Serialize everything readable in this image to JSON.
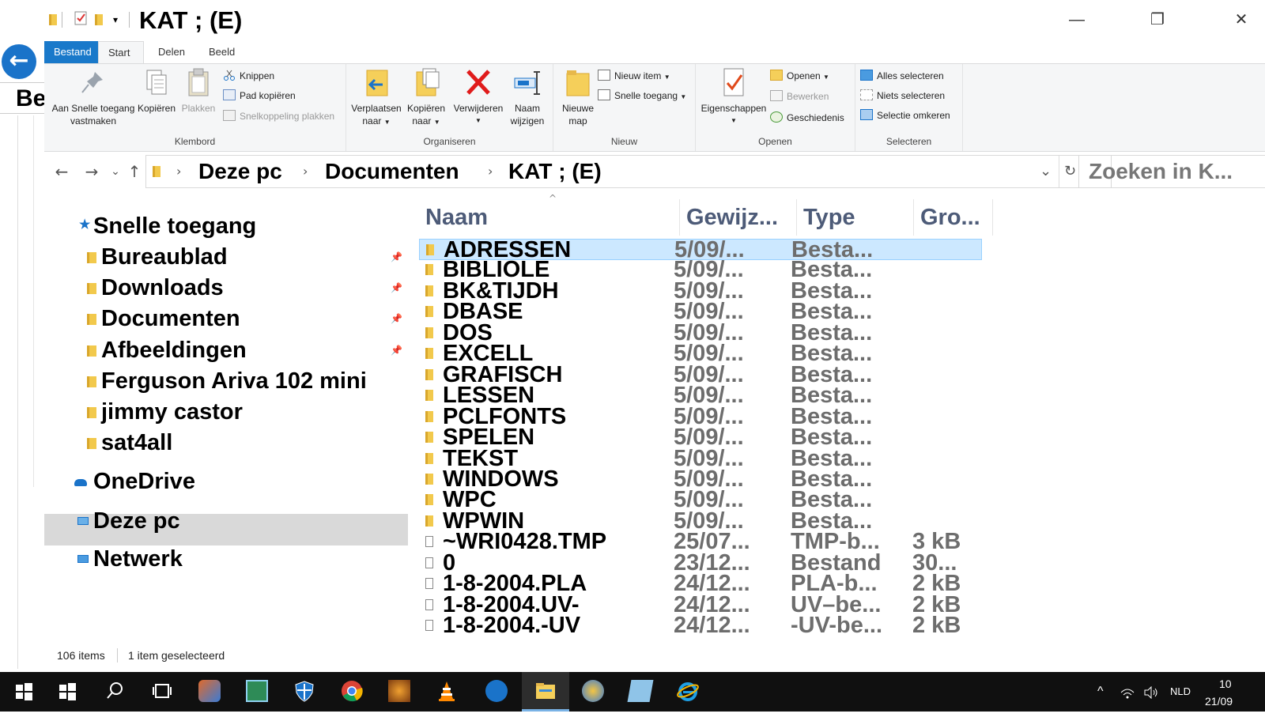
{
  "window": {
    "title": "KAT ; (E)",
    "controls": {
      "minimize": "—",
      "maximize": "❐",
      "close": "✕"
    }
  },
  "background_window": {
    "back_glyph": "←",
    "text": "Be"
  },
  "quick_access": {
    "dropdown": "▾"
  },
  "ribbon_tabs": [
    "Bestand",
    "Start",
    "Delen",
    "Beeld"
  ],
  "ribbon": {
    "klembord": {
      "label": "Klembord",
      "pin_line1": "Aan Snelle toegang",
      "pin_line2": "vastmaken",
      "copy": "Kopiëren",
      "paste": "Plakken",
      "cut": "Knippen",
      "copy_path": "Pad kopiëren",
      "paste_shortcut": "Snelkoppeling plakken"
    },
    "organiseren": {
      "label": "Organiseren",
      "move_line1": "Verplaatsen",
      "move_line2": "naar",
      "copyto_line1": "Kopiëren",
      "copyto_line2": "naar",
      "delete": "Verwijderen",
      "rename_line1": "Naam",
      "rename_line2": "wijzigen"
    },
    "nieuw": {
      "label": "Nieuw",
      "newfolder_line1": "Nieuwe",
      "newfolder_line2": "map",
      "new_item": "Nieuw item",
      "easy_access": "Snelle toegang"
    },
    "openen": {
      "label": "Openen",
      "properties": "Eigenschappen",
      "open": "Openen",
      "edit": "Bewerken",
      "history": "Geschiedenis"
    },
    "selecteren": {
      "label": "Selecteren",
      "select_all": "Alles selecteren",
      "select_none": "Niets selecteren",
      "invert": "Selectie omkeren"
    }
  },
  "nav_buttons": {
    "back": "←",
    "forward": "→",
    "recent": "⌄",
    "up": "↑",
    "dropdown": "⌄",
    "refresh": "↻"
  },
  "breadcrumb": {
    "sep": "›",
    "items": [
      "Deze pc",
      "Documenten",
      "KAT ; (E)"
    ]
  },
  "search": {
    "placeholder": "Zoeken in K..."
  },
  "nav_pane": {
    "quick_access": "Snelle toegang",
    "pinned": [
      "Bureaublad",
      "Downloads",
      "Documenten",
      "Afbeeldingen"
    ],
    "folders": [
      "Ferguson Ariva 102 mini",
      "jimmy castor",
      "sat4all"
    ],
    "onedrive": "OneDrive",
    "this_pc": "Deze pc",
    "network": "Netwerk",
    "pin_glyph": "📌"
  },
  "columns": {
    "name": "Naam",
    "modified": "Gewijz...",
    "type": "Type",
    "size": "Gro...",
    "sort_glyph": "^"
  },
  "files": [
    {
      "name": "ADRESSEN",
      "modified": "5/09/...",
      "type": "Besta...",
      "size": "",
      "kind": "folder"
    },
    {
      "name": "BIBLIOLE",
      "modified": "5/09/...",
      "type": "Besta...",
      "size": "",
      "kind": "folder"
    },
    {
      "name": "BK&TIJDH",
      "modified": "5/09/...",
      "type": "Besta...",
      "size": "",
      "kind": "folder"
    },
    {
      "name": "DBASE",
      "modified": "5/09/...",
      "type": "Besta...",
      "size": "",
      "kind": "folder"
    },
    {
      "name": "DOS",
      "modified": "5/09/...",
      "type": "Besta...",
      "size": "",
      "kind": "folder"
    },
    {
      "name": "EXCELL",
      "modified": "5/09/...",
      "type": "Besta...",
      "size": "",
      "kind": "folder"
    },
    {
      "name": "GRAFISCH",
      "modified": "5/09/...",
      "type": "Besta...",
      "size": "",
      "kind": "folder"
    },
    {
      "name": "LESSEN",
      "modified": "5/09/...",
      "type": "Besta...",
      "size": "",
      "kind": "folder"
    },
    {
      "name": "PCLFONTS",
      "modified": "5/09/...",
      "type": "Besta...",
      "size": "",
      "kind": "folder"
    },
    {
      "name": "SPELEN",
      "modified": "5/09/...",
      "type": "Besta...",
      "size": "",
      "kind": "folder"
    },
    {
      "name": "TEKST",
      "modified": "5/09/...",
      "type": "Besta...",
      "size": "",
      "kind": "folder"
    },
    {
      "name": "WINDOWS",
      "modified": "5/09/...",
      "type": "Besta...",
      "size": "",
      "kind": "folder"
    },
    {
      "name": "WPC",
      "modified": "5/09/...",
      "type": "Besta...",
      "size": "",
      "kind": "folder"
    },
    {
      "name": "WPWIN",
      "modified": "5/09/...",
      "type": "Besta...",
      "size": "",
      "kind": "folder"
    },
    {
      "name": "~WRI0428.TMP",
      "modified": "25/07...",
      "type": "TMP-b...",
      "size": "3 kB",
      "kind": "file"
    },
    {
      "name": "0",
      "modified": "23/12...",
      "type": "Bestand",
      "size": "30...",
      "kind": "file"
    },
    {
      "name": "1-8-2004.PLA",
      "modified": "24/12...",
      "type": "PLA-b...",
      "size": "2 kB",
      "kind": "file"
    },
    {
      "name": "1-8-2004.UV-",
      "modified": "24/12...",
      "type": "UV–be...",
      "size": "2 kB",
      "kind": "file"
    },
    {
      "name": "1-8-2004.-UV",
      "modified": "24/12...",
      "type": "-UV-be...",
      "size": "2 kB",
      "kind": "file"
    }
  ],
  "status": {
    "count": "106 items",
    "selected": "1 item geselecteerd"
  },
  "taskbar": {
    "apps": [
      "start",
      "windows-icon",
      "search",
      "task-view",
      "paint-app",
      "mail-app",
      "security-app",
      "chrome",
      "photo-app",
      "vlc",
      "bird-app",
      "file-explorer",
      "paint-3d",
      "notepad-app",
      "internet-explorer"
    ],
    "tray": {
      "chevron": "^",
      "lang": "NLD",
      "time": "10",
      "date": "21/09"
    }
  },
  "colors": {
    "accent": "#1979ca",
    "selection": "#cce8ff",
    "folder": "#f2c94c",
    "header_text": "#4d5b78"
  }
}
